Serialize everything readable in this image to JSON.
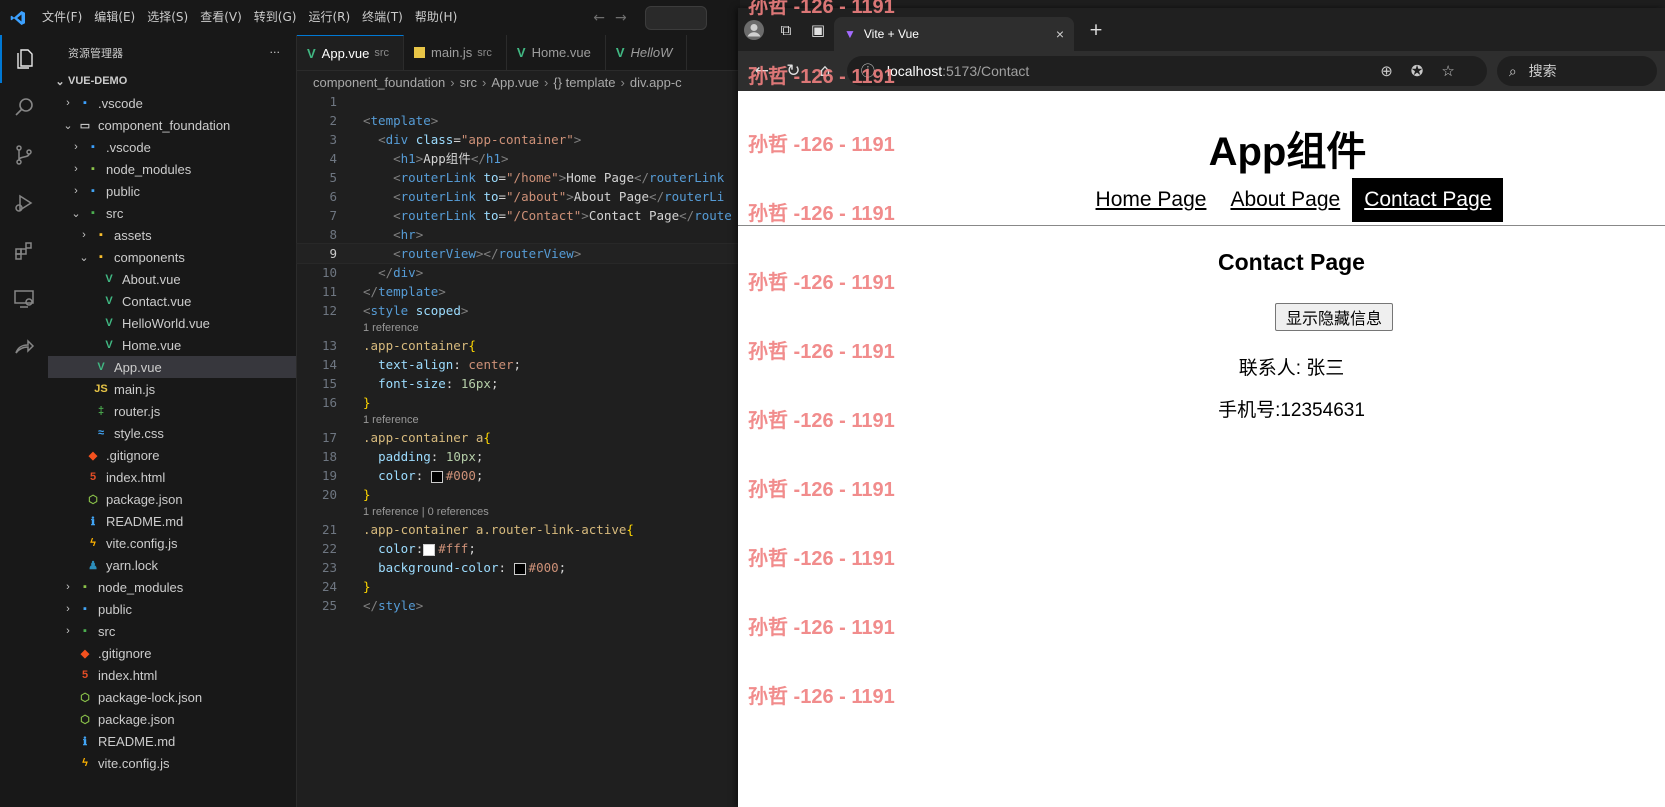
{
  "vscode": {
    "menu": [
      "文件(F)",
      "编辑(E)",
      "选择(S)",
      "查看(V)",
      "转到(G)",
      "运行(R)",
      "终端(T)",
      "帮助(H)"
    ],
    "explorer_title": "资源管理器",
    "explorer_more": "···",
    "tree": [
      {
        "label": "VUE-DEMO",
        "chev": "⌄",
        "icon": "",
        "root": true
      },
      {
        "label": ".vscode",
        "chev": "›",
        "icon": "▪",
        "color": "#3ca1ff"
      },
      {
        "label": "component_foundation",
        "chev": "⌄",
        "icon": "▭",
        "color": "#c5c5c5"
      },
      {
        "label": ".vscode",
        "chev": "›",
        "icon": "▪",
        "color": "#3ca1ff"
      },
      {
        "label": "node_modules",
        "chev": "›",
        "icon": "▪",
        "color": "#8bc34a"
      },
      {
        "label": "public",
        "chev": "›",
        "icon": "▪",
        "color": "#42a5f5"
      },
      {
        "label": "src",
        "chev": "⌄",
        "icon": "▪",
        "color": "#4caf50"
      },
      {
        "label": "assets",
        "chev": "›",
        "icon": "▪",
        "color": "#fbc02d"
      },
      {
        "label": "components",
        "chev": "⌄",
        "icon": "▪",
        "color": "#fbc02d"
      },
      {
        "label": "About.vue",
        "chev": "",
        "icon": "V",
        "color": "#41b883"
      },
      {
        "label": "Contact.vue",
        "chev": "",
        "icon": "V",
        "color": "#41b883"
      },
      {
        "label": "HelloWorld.vue",
        "chev": "",
        "icon": "V",
        "color": "#41b883"
      },
      {
        "label": "Home.vue",
        "chev": "",
        "icon": "V",
        "color": "#41b883"
      },
      {
        "label": "App.vue",
        "chev": "",
        "icon": "V",
        "color": "#41b883",
        "selected": true
      },
      {
        "label": "main.js",
        "chev": "",
        "icon": "JS",
        "color": "#e8c547"
      },
      {
        "label": "router.js",
        "chev": "",
        "icon": "‡",
        "color": "#4caf50"
      },
      {
        "label": "style.css",
        "chev": "",
        "icon": "≈",
        "color": "#42a5f5"
      },
      {
        "label": ".gitignore",
        "chev": "",
        "icon": "◆",
        "color": "#f4511e"
      },
      {
        "label": "index.html",
        "chev": "",
        "icon": "5",
        "color": "#e44d26"
      },
      {
        "label": "package.json",
        "chev": "",
        "icon": "⬡",
        "color": "#8bc34a"
      },
      {
        "label": "README.md",
        "chev": "",
        "icon": "ℹ",
        "color": "#42a5f5"
      },
      {
        "label": "vite.config.js",
        "chev": "",
        "icon": "ϟ",
        "color": "#ffb300"
      },
      {
        "label": "yarn.lock",
        "chev": "",
        "icon": "♟",
        "color": "#2c8ebb"
      },
      {
        "label": "node_modules",
        "chev": "›",
        "icon": "▪",
        "color": "#8bc34a"
      },
      {
        "label": "public",
        "chev": "›",
        "icon": "▪",
        "color": "#42a5f5"
      },
      {
        "label": "src",
        "chev": "›",
        "icon": "▪",
        "color": "#4caf50"
      },
      {
        "label": ".gitignore",
        "chev": "",
        "icon": "◆",
        "color": "#f4511e"
      },
      {
        "label": "index.html",
        "chev": "",
        "icon": "5",
        "color": "#e44d26"
      },
      {
        "label": "package-lock.json",
        "chev": "",
        "icon": "⬡",
        "color": "#8bc34a"
      },
      {
        "label": "package.json",
        "chev": "",
        "icon": "⬡",
        "color": "#8bc34a"
      },
      {
        "label": "README.md",
        "chev": "",
        "icon": "ℹ",
        "color": "#42a5f5"
      },
      {
        "label": "vite.config.js",
        "chev": "",
        "icon": "ϟ",
        "color": "#ffb300"
      }
    ],
    "tabs": [
      {
        "label": "App.vue",
        "sub": "src",
        "type": "vue",
        "active": true
      },
      {
        "label": "main.js",
        "sub": "src",
        "type": "js"
      },
      {
        "label": "Home.vue",
        "sub": "",
        "type": "vue"
      },
      {
        "label": "HelloW",
        "sub": "",
        "type": "vue"
      }
    ],
    "breadcrumb": [
      "component_foundation",
      "src",
      "App.vue",
      "{} template",
      "div.app-c"
    ],
    "lens_1": "1 reference",
    "lens_2": "1 reference",
    "lens_3": "1 reference | 0 references"
  },
  "browser": {
    "tab_title": "Vite + Vue",
    "tab_close": "×",
    "new_tab": "+",
    "url_host": "localhost",
    "url_path": ":5173/Contact",
    "search_label": "搜索",
    "page": {
      "title": "App组件",
      "links": [
        "Home Page",
        "About Page",
        "Contact Page"
      ],
      "active_link": 2,
      "contact_title": "Contact Page",
      "toggle_button": "显示隐藏信息",
      "contact_person": "联系人: 张三",
      "phone": "手机号:12354631"
    },
    "watermark": "孙哲 -126 - 1191"
  }
}
